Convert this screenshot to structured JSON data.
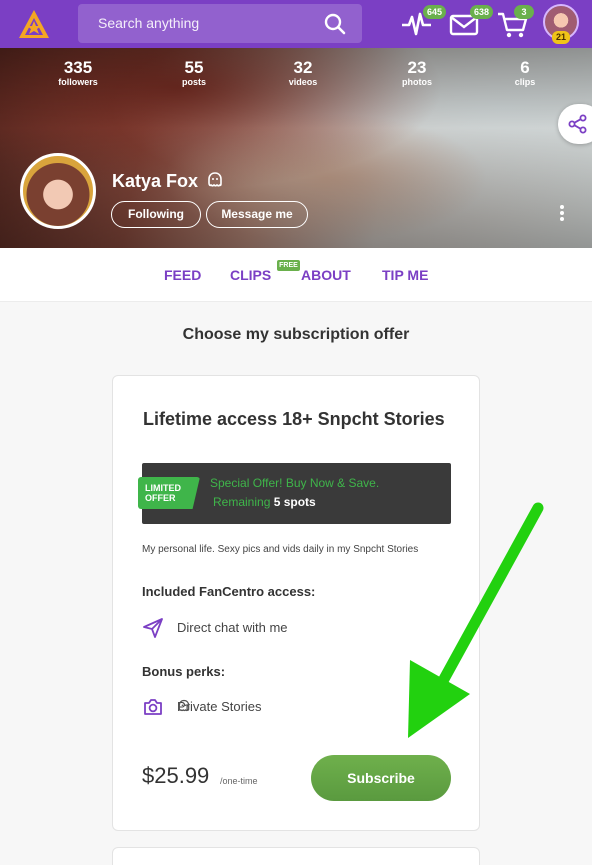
{
  "header": {
    "search_placeholder": "Search anything",
    "notifications_count": "645",
    "messages_count": "638",
    "cart_count": "3",
    "user_level": "21"
  },
  "profile": {
    "stats": [
      {
        "num": "335",
        "label": "followers"
      },
      {
        "num": "55",
        "label": "posts"
      },
      {
        "num": "32",
        "label": "videos"
      },
      {
        "num": "23",
        "label": "photos"
      },
      {
        "num": "6",
        "label": "clips"
      }
    ],
    "name": "Katya Fox",
    "following_label": "Following",
    "message_label": "Message me"
  },
  "tabs": {
    "feed": "FEED",
    "clips": "CLIPS",
    "clips_badge": "FREE",
    "about": "ABOUT",
    "tip": "TIP ME"
  },
  "section_title": "Choose my subscription offer",
  "offer": {
    "title": "Lifetime access 18+ Snpcht Stories",
    "limited_label_1": "LIMITED",
    "limited_label_2": "OFFER",
    "special_text": "Special Offer! Buy Now & Save.",
    "remaining_prefix": "Remaining",
    "remaining_spots": "5 spots",
    "description": "My personal life. Sexy pics and vids daily in my Snpcht Stories",
    "included_heading": "Included FanCentro access:",
    "included_item": "Direct chat with me",
    "bonus_heading": "Bonus perks:",
    "bonus_item": "Private Stories",
    "price": "$25.99",
    "price_unit": "/one-time",
    "subscribe_label": "Subscribe"
  },
  "colors": {
    "brand_purple": "#7b3fc4",
    "green": "#6ab04c",
    "arrow_green": "#22d10f"
  }
}
